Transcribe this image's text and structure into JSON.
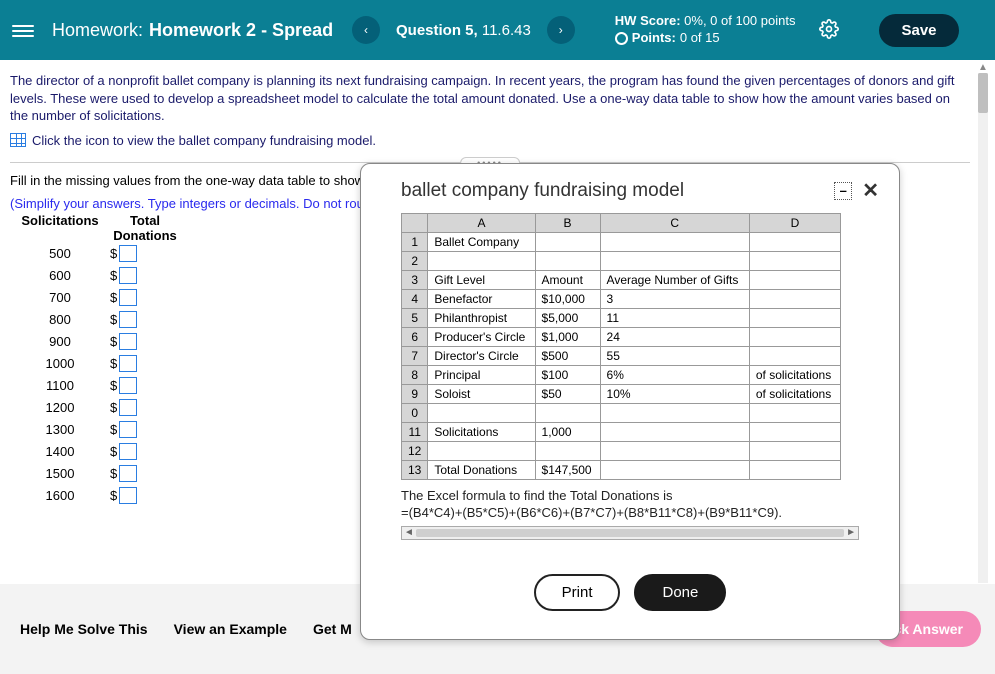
{
  "header": {
    "hw_label": "Homework:",
    "hw_name": "Homework 2 - Spread...",
    "prev": "‹",
    "next": "›",
    "question_label": "Question 5,",
    "question_ref": "11.6.43",
    "score_line1_label": "HW Score:",
    "score_line1_val": "0%, 0 of 100 points",
    "points_label": "Points:",
    "points_val": "0 of 15",
    "save": "Save"
  },
  "problem": {
    "text": "The director of a nonprofit ballet company is planning its next fundraising campaign. In recent years, the program has found the given percentages of donors and gift levels. These were used to develop a spreadsheet model to calculate the total amount donated. Use a one-way data table to show how the amount varies based on the number of solicitations.",
    "hint": "Click the icon to view the ballet company fundraising model.",
    "instruction": "Fill in the missing values from the one-way data table to show how the amount varies based on the number of solicitations.",
    "simplify": "(Simplify your answers. Type integers or decimals. Do not round.)",
    "col1": "Solicitations",
    "col2": "Total Donations",
    "rows": [
      "500",
      "600",
      "700",
      "800",
      "900",
      "1000",
      "1100",
      "1200",
      "1300",
      "1400",
      "1500",
      "1600"
    ],
    "dollar": "$"
  },
  "bottom": {
    "help": "Help Me Solve This",
    "example": "View an Example",
    "more": "Get M",
    "check": "ck Answer"
  },
  "modal": {
    "title": "ballet company fundraising model",
    "minimize": "–",
    "close": "✕",
    "print": "Print",
    "done": "Done",
    "note1": "The Excel formula to find the Total Donations is",
    "note2": "=(B4*C4)+(B5*C5)+(B6*C6)+(B7*C7)+(B8*B11*C8)+(B9*B11*C9).",
    "cols": [
      "",
      "A",
      "B",
      "C",
      "D"
    ],
    "sheet": [
      {
        "n": "1",
        "a": "Ballet Company",
        "b": "",
        "c": "",
        "d": ""
      },
      {
        "n": "2",
        "a": "",
        "b": "",
        "c": "",
        "d": ""
      },
      {
        "n": "3",
        "a": "Gift Level",
        "b": "Amount",
        "c": "Average Number of Gifts",
        "d": ""
      },
      {
        "n": "4",
        "a": "Benefactor",
        "b": "$10,000",
        "c": "3",
        "d": ""
      },
      {
        "n": "5",
        "a": "Philanthropist",
        "b": "$5,000",
        "c": "11",
        "d": ""
      },
      {
        "n": "6",
        "a": "Producer's Circle",
        "b": "$1,000",
        "c": "24",
        "d": ""
      },
      {
        "n": "7",
        "a": "Director's Circle",
        "b": "$500",
        "c": "55",
        "d": ""
      },
      {
        "n": "8",
        "a": "Principal",
        "b": "$100",
        "c": "6%",
        "d": "of solicitations"
      },
      {
        "n": "9",
        "a": "Soloist",
        "b": "$50",
        "c": "10%",
        "d": "of solicitations"
      },
      {
        "n": "0",
        "a": "",
        "b": "",
        "c": "",
        "d": ""
      },
      {
        "n": "11",
        "a": "Solicitations",
        "b": "1,000",
        "c": "",
        "d": ""
      },
      {
        "n": "12",
        "a": "",
        "b": "",
        "c": "",
        "d": ""
      },
      {
        "n": "13",
        "a": "Total Donations",
        "b": "$147,500",
        "c": "",
        "d": ""
      }
    ]
  }
}
